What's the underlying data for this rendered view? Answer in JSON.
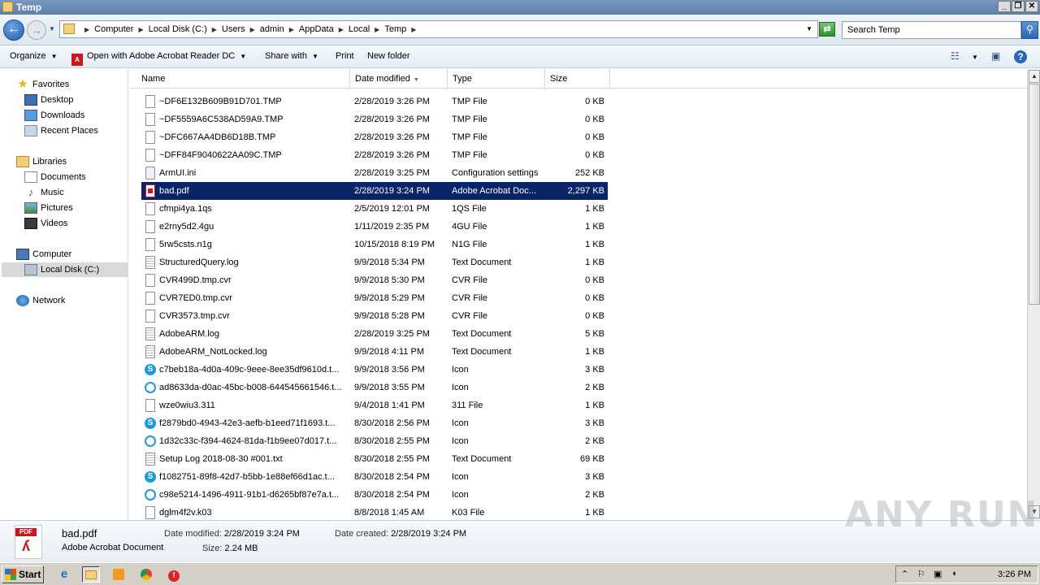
{
  "window": {
    "title": "Temp"
  },
  "nav_buttons": {
    "back": "←",
    "forward": "→",
    "search_glyph": "⚲"
  },
  "address": {
    "crumbs": [
      "Computer",
      "Local Disk (C:)",
      "Users",
      "admin",
      "AppData",
      "Local",
      "Temp"
    ]
  },
  "search": {
    "placeholder": "Search Temp"
  },
  "toolbar": {
    "organize": "Organize",
    "open_with": "Open with Adobe Acrobat Reader DC",
    "share_with": "Share with",
    "print": "Print",
    "new_folder": "New folder",
    "help_glyph": "?"
  },
  "sidebar": {
    "favorites": "Favorites",
    "desktop": "Desktop",
    "downloads": "Downloads",
    "recent_places": "Recent Places",
    "libraries": "Libraries",
    "documents": "Documents",
    "music": "Music",
    "pictures": "Pictures",
    "videos": "Videos",
    "computer": "Computer",
    "local_disk": "Local Disk (C:)",
    "network": "Network"
  },
  "columns": {
    "name": "Name",
    "date_modified": "Date modified",
    "type": "Type",
    "size": "Size"
  },
  "files": [
    {
      "name": "~DF6E132B609B91D701.TMP",
      "date": "2/28/2019 3:26 PM",
      "type": "TMP File",
      "size": "0 KB",
      "icon": "generic"
    },
    {
      "name": "~DF5559A6C538AD59A9.TMP",
      "date": "2/28/2019 3:26 PM",
      "type": "TMP File",
      "size": "0 KB",
      "icon": "generic"
    },
    {
      "name": "~DFC667AA4DB6D18B.TMP",
      "date": "2/28/2019 3:26 PM",
      "type": "TMP File",
      "size": "0 KB",
      "icon": "generic"
    },
    {
      "name": "~DFF84F9040622AA09C.TMP",
      "date": "2/28/2019 3:26 PM",
      "type": "TMP File",
      "size": "0 KB",
      "icon": "generic"
    },
    {
      "name": "ArmUI.ini",
      "date": "2/28/2019 3:25 PM",
      "type": "Configuration settings",
      "size": "252 KB",
      "icon": "ini"
    },
    {
      "name": "bad.pdf",
      "date": "2/28/2019 3:24 PM",
      "type": "Adobe Acrobat Doc...",
      "size": "2,297 KB",
      "icon": "pdf",
      "selected": true
    },
    {
      "name": "cfmpi4ya.1qs",
      "date": "2/5/2019 12:01 PM",
      "type": "1QS File",
      "size": "1 KB",
      "icon": "generic"
    },
    {
      "name": "e2rny5d2.4gu",
      "date": "1/11/2019 2:35 PM",
      "type": "4GU File",
      "size": "1 KB",
      "icon": "generic"
    },
    {
      "name": "5rw5csts.n1g",
      "date": "10/15/2018 8:19 PM",
      "type": "N1G File",
      "size": "1 KB",
      "icon": "generic"
    },
    {
      "name": "StructuredQuery.log",
      "date": "9/9/2018 5:34 PM",
      "type": "Text Document",
      "size": "1 KB",
      "icon": "text"
    },
    {
      "name": "CVR499D.tmp.cvr",
      "date": "9/9/2018 5:30 PM",
      "type": "CVR File",
      "size": "0 KB",
      "icon": "generic"
    },
    {
      "name": "CVR7ED0.tmp.cvr",
      "date": "9/9/2018 5:29 PM",
      "type": "CVR File",
      "size": "0 KB",
      "icon": "generic"
    },
    {
      "name": "CVR3573.tmp.cvr",
      "date": "9/9/2018 5:28 PM",
      "type": "CVR File",
      "size": "0 KB",
      "icon": "generic"
    },
    {
      "name": "AdobeARM.log",
      "date": "2/28/2019 3:25 PM",
      "type": "Text Document",
      "size": "5 KB",
      "icon": "text"
    },
    {
      "name": "AdobeARM_NotLocked.log",
      "date": "9/9/2018 4:11 PM",
      "type": "Text Document",
      "size": "1 KB",
      "icon": "text"
    },
    {
      "name": "c7beb18a-4d0a-409c-9eee-8ee35df9610d.t...",
      "date": "9/9/2018 3:56 PM",
      "type": "Icon",
      "size": "3 KB",
      "icon": "skype"
    },
    {
      "name": "ad8633da-d0ac-45bc-b008-644545661546.t...",
      "date": "9/9/2018 3:55 PM",
      "type": "Icon",
      "size": "2 KB",
      "icon": "skype-outline"
    },
    {
      "name": "wze0wiu3.311",
      "date": "9/4/2018 1:41 PM",
      "type": "311 File",
      "size": "1 KB",
      "icon": "generic"
    },
    {
      "name": "f2879bd0-4943-42e3-aefb-b1eed71f1693.t...",
      "date": "8/30/2018 2:56 PM",
      "type": "Icon",
      "size": "3 KB",
      "icon": "skype"
    },
    {
      "name": "1d32c33c-f394-4624-81da-f1b9ee07d017.t...",
      "date": "8/30/2018 2:55 PM",
      "type": "Icon",
      "size": "2 KB",
      "icon": "skype-outline"
    },
    {
      "name": "Setup Log 2018-08-30 #001.txt",
      "date": "8/30/2018 2:55 PM",
      "type": "Text Document",
      "size": "69 KB",
      "icon": "text"
    },
    {
      "name": "f1082751-89f8-42d7-b5bb-1e88ef66d1ac.t...",
      "date": "8/30/2018 2:54 PM",
      "type": "Icon",
      "size": "3 KB",
      "icon": "skype"
    },
    {
      "name": "c98e5214-1496-4911-91b1-d6265bf87e7a.t...",
      "date": "8/30/2018 2:54 PM",
      "type": "Icon",
      "size": "2 KB",
      "icon": "skype-outline"
    },
    {
      "name": "dglm4f2v.k03",
      "date": "8/8/2018 1:45 AM",
      "type": "K03 File",
      "size": "1 KB",
      "icon": "generic"
    }
  ],
  "details": {
    "icon_tag": "PDF",
    "name": "bad.pdf",
    "type": "Adobe Acrobat Document",
    "date_modified_label": "Date modified:",
    "date_modified": "2/28/2019 3:24 PM",
    "date_created_label": "Date created:",
    "date_created": "2/28/2019 3:24 PM",
    "size_label": "Size:",
    "size": "2.24 MB"
  },
  "watermark": "ANY RUN",
  "taskbar": {
    "start": "Start",
    "clock": "3:26 PM"
  }
}
